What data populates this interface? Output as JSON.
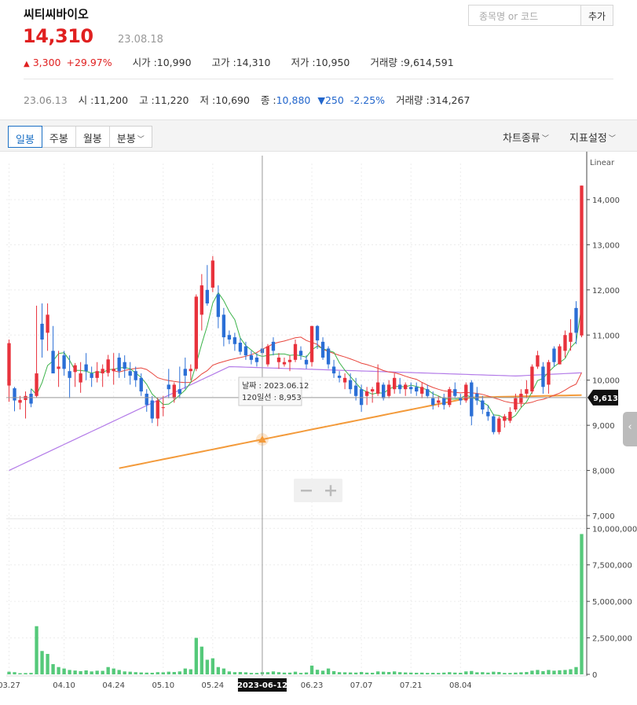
{
  "stock": {
    "name": "씨티씨바이오",
    "price": "14,310",
    "date": "23.08.18",
    "change_arrow": "▲",
    "change": "3,300",
    "change_pct": "+29.97%",
    "open_label": "시가 : ",
    "open": "10,990",
    "high_label": "고가 : ",
    "high": "14,310",
    "low_label": "저가 : ",
    "low": "10,950",
    "volume_label": "거래량 : ",
    "volume": "9,614,591"
  },
  "search": {
    "placeholder": "종목명 or 코드",
    "add_label": "추가"
  },
  "hover_info": {
    "date": "23.06.13",
    "open_label": "시 : ",
    "open": "11,200",
    "high_label": "고 : ",
    "high": "11,220",
    "low_label": "저 : ",
    "low": "10,690",
    "close_label": "종 : ",
    "close": "10,880",
    "change_arrow": "▼",
    "change": "250",
    "change_pct": "-2.25%",
    "volume_label": "거래량 : ",
    "volume": "314,267"
  },
  "toolbar": {
    "tabs": [
      "일봉",
      "주봉",
      "월봉",
      "분봉"
    ],
    "active_tab": 0,
    "chart_type_label": "차트종류",
    "indicator_label": "지표설정"
  },
  "chart_data": {
    "type": "candlestick",
    "scale_label": "Linear",
    "price_ylim": [
      7000,
      14800
    ],
    "price_ticks": [
      7000,
      8000,
      9000,
      10000,
      11000,
      12000,
      13000,
      14000
    ],
    "price_tick_labels": [
      "7,000",
      "8,000",
      "9,000",
      "10,000",
      "11,000",
      "12,000",
      "13,000",
      "14,000"
    ],
    "volume_ylim": [
      0,
      10500000
    ],
    "volume_ticks": [
      0,
      2500000,
      5000000,
      7500000,
      10000000
    ],
    "volume_tick_labels": [
      "0",
      "2,500,000",
      "5,000,000",
      "7,500,000",
      "10,000,000"
    ],
    "x_tick_labels": [
      "03.27",
      "04.10",
      "04.24",
      "05.10",
      "05.24",
      "06.23",
      "07.07",
      "07.21",
      "08.04"
    ],
    "x_tick_index": [
      0,
      10,
      19,
      28,
      37,
      55,
      64,
      73,
      82
    ],
    "crosshair_index": 46,
    "crosshair_date_label": "2023-06-12",
    "crosshair_price": 9613,
    "crosshair_price_label": "9,613",
    "tooltip": {
      "date_label": "날짜 : ",
      "date": "2023.06.12",
      "ma_label": "120일선 : ",
      "ma_value": "8,953"
    },
    "ma_colors": [
      "#3cb34a",
      "#e8453c",
      "#b37be8",
      "#f39a3a"
    ],
    "up_color": "#e8323c",
    "down_color": "#2b6fd6",
    "volume_color": "#55c97a",
    "candles": [
      {
        "o": 9880,
        "h": 10900,
        "l": 9520,
        "c": 10820,
        "v": 180000
      },
      {
        "o": 9820,
        "h": 9850,
        "l": 9310,
        "c": 9550,
        "v": 150000
      },
      {
        "o": 9500,
        "h": 9650,
        "l": 9350,
        "c": 9560,
        "v": 80000
      },
      {
        "o": 9560,
        "h": 9750,
        "l": 9150,
        "c": 9650,
        "v": 90000
      },
      {
        "o": 9700,
        "h": 9800,
        "l": 9400,
        "c": 9480,
        "v": 100000
      },
      {
        "o": 9650,
        "h": 11650,
        "l": 9620,
        "c": 10150,
        "v": 3300000
      },
      {
        "o": 11250,
        "h": 11700,
        "l": 10500,
        "c": 10900,
        "v": 1600000
      },
      {
        "o": 11050,
        "h": 11700,
        "l": 10650,
        "c": 11450,
        "v": 1400000
      },
      {
        "o": 10650,
        "h": 11200,
        "l": 10250,
        "c": 10150,
        "v": 700000
      },
      {
        "o": 10250,
        "h": 10650,
        "l": 9850,
        "c": 10300,
        "v": 500000
      },
      {
        "o": 10550,
        "h": 10650,
        "l": 10100,
        "c": 10250,
        "v": 400000
      },
      {
        "o": 10200,
        "h": 10550,
        "l": 9600,
        "c": 10050,
        "v": 300000
      },
      {
        "o": 10180,
        "h": 10380,
        "l": 9850,
        "c": 10330,
        "v": 260000
      },
      {
        "o": 9950,
        "h": 10400,
        "l": 9720,
        "c": 10150,
        "v": 220000
      },
      {
        "o": 10350,
        "h": 10600,
        "l": 10000,
        "c": 10200,
        "v": 270000
      },
      {
        "o": 10150,
        "h": 10300,
        "l": 9850,
        "c": 10050,
        "v": 200000
      },
      {
        "o": 10050,
        "h": 10400,
        "l": 9950,
        "c": 10200,
        "v": 250000
      },
      {
        "o": 10150,
        "h": 10350,
        "l": 9850,
        "c": 10250,
        "v": 240000
      },
      {
        "o": 10160,
        "h": 10560,
        "l": 10080,
        "c": 10460,
        "v": 500000
      },
      {
        "o": 10200,
        "h": 10600,
        "l": 9900,
        "c": 10250,
        "v": 400000
      },
      {
        "o": 10500,
        "h": 10600,
        "l": 10050,
        "c": 10200,
        "v": 300000
      },
      {
        "o": 10400,
        "h": 10550,
        "l": 10050,
        "c": 10250,
        "v": 200000
      },
      {
        "o": 10200,
        "h": 10400,
        "l": 9900,
        "c": 10100,
        "v": 180000
      },
      {
        "o": 10200,
        "h": 10300,
        "l": 9850,
        "c": 10000,
        "v": 150000
      },
      {
        "o": 10050,
        "h": 10150,
        "l": 9650,
        "c": 9750,
        "v": 130000
      },
      {
        "o": 9700,
        "h": 9800,
        "l": 9300,
        "c": 9450,
        "v": 120000
      },
      {
        "o": 9550,
        "h": 9650,
        "l": 9050,
        "c": 9150,
        "v": 110000
      },
      {
        "o": 9150,
        "h": 9620,
        "l": 8980,
        "c": 9550,
        "v": 150000
      },
      {
        "o": 9400,
        "h": 9650,
        "l": 9200,
        "c": 9400,
        "v": 140000
      },
      {
        "o": 9900,
        "h": 10250,
        "l": 9600,
        "c": 9800,
        "v": 180000
      },
      {
        "o": 9600,
        "h": 9950,
        "l": 9500,
        "c": 9900,
        "v": 160000
      },
      {
        "o": 9800,
        "h": 10300,
        "l": 9600,
        "c": 9700,
        "v": 200000
      },
      {
        "o": 10250,
        "h": 10500,
        "l": 9800,
        "c": 10100,
        "v": 400000
      },
      {
        "o": 10200,
        "h": 10350,
        "l": 10000,
        "c": 10250,
        "v": 350000
      },
      {
        "o": 10250,
        "h": 11900,
        "l": 10200,
        "c": 11850,
        "v": 2500000
      },
      {
        "o": 11450,
        "h": 12350,
        "l": 11100,
        "c": 12100,
        "v": 1900000
      },
      {
        "o": 12000,
        "h": 12550,
        "l": 11650,
        "c": 11700,
        "v": 1000000
      },
      {
        "o": 12050,
        "h": 12750,
        "l": 11950,
        "c": 12650,
        "v": 1100000
      },
      {
        "o": 11900,
        "h": 12100,
        "l": 11150,
        "c": 11400,
        "v": 500000
      },
      {
        "o": 11450,
        "h": 11600,
        "l": 10750,
        "c": 10950,
        "v": 400000
      },
      {
        "o": 11000,
        "h": 11100,
        "l": 10800,
        "c": 10900,
        "v": 200000
      },
      {
        "o": 10950,
        "h": 11050,
        "l": 10650,
        "c": 10800,
        "v": 150000
      },
      {
        "o": 10830,
        "h": 10930,
        "l": 10560,
        "c": 10630,
        "v": 160000
      },
      {
        "o": 10750,
        "h": 10850,
        "l": 10450,
        "c": 10550,
        "v": 140000
      },
      {
        "o": 10550,
        "h": 10650,
        "l": 10350,
        "c": 10450,
        "v": 100000
      },
      {
        "o": 10500,
        "h": 10600,
        "l": 10300,
        "c": 10400,
        "v": 100000
      },
      {
        "o": 10700,
        "h": 10850,
        "l": 10450,
        "c": 10600,
        "v": 150000
      },
      {
        "o": 10350,
        "h": 10800,
        "l": 10300,
        "c": 10750,
        "v": 150000
      },
      {
        "o": 10850,
        "h": 10950,
        "l": 10550,
        "c": 10650,
        "v": 200000
      },
      {
        "o": 10400,
        "h": 10600,
        "l": 10250,
        "c": 10500,
        "v": 150000
      },
      {
        "o": 10350,
        "h": 10500,
        "l": 10300,
        "c": 10400,
        "v": 120000
      },
      {
        "o": 10400,
        "h": 10550,
        "l": 10200,
        "c": 10450,
        "v": 120000
      },
      {
        "o": 10450,
        "h": 10900,
        "l": 10400,
        "c": 10800,
        "v": 180000
      },
      {
        "o": 10650,
        "h": 10750,
        "l": 10450,
        "c": 10550,
        "v": 100000
      },
      {
        "o": 10450,
        "h": 10550,
        "l": 10250,
        "c": 10350,
        "v": 130000
      },
      {
        "o": 10400,
        "h": 11200,
        "l": 10300,
        "c": 11200,
        "v": 600000
      },
      {
        "o": 11200,
        "h": 11220,
        "l": 10690,
        "c": 10880,
        "v": 314267
      },
      {
        "o": 10850,
        "h": 10950,
        "l": 10450,
        "c": 10500,
        "v": 250000
      },
      {
        "o": 10700,
        "h": 10750,
        "l": 10250,
        "c": 10350,
        "v": 400000
      },
      {
        "o": 10300,
        "h": 10450,
        "l": 10050,
        "c": 10150,
        "v": 220000
      },
      {
        "o": 10100,
        "h": 10200,
        "l": 9950,
        "c": 10050,
        "v": 150000
      },
      {
        "o": 9950,
        "h": 10150,
        "l": 9800,
        "c": 10050,
        "v": 140000
      },
      {
        "o": 10000,
        "h": 10150,
        "l": 9700,
        "c": 9800,
        "v": 130000
      },
      {
        "o": 9880,
        "h": 10050,
        "l": 9550,
        "c": 9650,
        "v": 120000
      },
      {
        "o": 9800,
        "h": 9900,
        "l": 9300,
        "c": 9450,
        "v": 160000
      },
      {
        "o": 9650,
        "h": 9850,
        "l": 9450,
        "c": 9750,
        "v": 120000
      },
      {
        "o": 9750,
        "h": 9850,
        "l": 9500,
        "c": 9800,
        "v": 110000
      },
      {
        "o": 9700,
        "h": 10350,
        "l": 9650,
        "c": 9950,
        "v": 200000
      },
      {
        "o": 9900,
        "h": 9950,
        "l": 9550,
        "c": 9600,
        "v": 180000
      },
      {
        "o": 9650,
        "h": 10000,
        "l": 9600,
        "c": 9900,
        "v": 160000
      },
      {
        "o": 9800,
        "h": 10150,
        "l": 9700,
        "c": 10050,
        "v": 200000
      },
      {
        "o": 9900,
        "h": 10050,
        "l": 9700,
        "c": 9800,
        "v": 150000
      },
      {
        "o": 9800,
        "h": 9950,
        "l": 9650,
        "c": 9900,
        "v": 130000
      },
      {
        "o": 9850,
        "h": 9950,
        "l": 9700,
        "c": 9800,
        "v": 120000
      },
      {
        "o": 9850,
        "h": 9950,
        "l": 9650,
        "c": 9750,
        "v": 110000
      },
      {
        "o": 9700,
        "h": 9950,
        "l": 9600,
        "c": 9850,
        "v": 120000
      },
      {
        "o": 9800,
        "h": 9900,
        "l": 9600,
        "c": 9650,
        "v": 100000
      },
      {
        "o": 9600,
        "h": 9750,
        "l": 9350,
        "c": 9450,
        "v": 110000
      },
      {
        "o": 9500,
        "h": 9650,
        "l": 9400,
        "c": 9550,
        "v": 100000
      },
      {
        "o": 9600,
        "h": 9700,
        "l": 9350,
        "c": 9450,
        "v": 120000
      },
      {
        "o": 9450,
        "h": 9850,
        "l": 9400,
        "c": 9800,
        "v": 150000
      },
      {
        "o": 9800,
        "h": 9950,
        "l": 9600,
        "c": 9650,
        "v": 120000
      },
      {
        "o": 9600,
        "h": 9700,
        "l": 9450,
        "c": 9550,
        "v": 110000
      },
      {
        "o": 9550,
        "h": 9950,
        "l": 9500,
        "c": 9900,
        "v": 200000
      },
      {
        "o": 9950,
        "h": 10000,
        "l": 9000,
        "c": 9200,
        "v": 230000
      },
      {
        "o": 9700,
        "h": 9850,
        "l": 9450,
        "c": 9550,
        "v": 140000
      },
      {
        "o": 9550,
        "h": 9650,
        "l": 9250,
        "c": 9350,
        "v": 150000
      },
      {
        "o": 9300,
        "h": 9450,
        "l": 9100,
        "c": 9200,
        "v": 120000
      },
      {
        "o": 9200,
        "h": 9250,
        "l": 8800,
        "c": 8850,
        "v": 180000
      },
      {
        "o": 8850,
        "h": 9200,
        "l": 8800,
        "c": 9150,
        "v": 160000
      },
      {
        "o": 9100,
        "h": 9250,
        "l": 8950,
        "c": 9200,
        "v": 100000
      },
      {
        "o": 9100,
        "h": 9400,
        "l": 9050,
        "c": 9300,
        "v": 100000
      },
      {
        "o": 9350,
        "h": 9700,
        "l": 9300,
        "c": 9600,
        "v": 120000
      },
      {
        "o": 9500,
        "h": 9800,
        "l": 9400,
        "c": 9700,
        "v": 140000
      },
      {
        "o": 9700,
        "h": 10000,
        "l": 9600,
        "c": 9800,
        "v": 160000
      },
      {
        "o": 9750,
        "h": 10350,
        "l": 9700,
        "c": 10300,
        "v": 250000
      },
      {
        "o": 10300,
        "h": 10650,
        "l": 10250,
        "c": 10550,
        "v": 300000
      },
      {
        "o": 10300,
        "h": 10400,
        "l": 9700,
        "c": 9850,
        "v": 220000
      },
      {
        "o": 9900,
        "h": 10450,
        "l": 9700,
        "c": 10400,
        "v": 300000
      },
      {
        "o": 10700,
        "h": 10750,
        "l": 10300,
        "c": 10400,
        "v": 250000
      },
      {
        "o": 10350,
        "h": 10800,
        "l": 10350,
        "c": 10750,
        "v": 280000
      },
      {
        "o": 10650,
        "h": 11100,
        "l": 10500,
        "c": 11000,
        "v": 300000
      },
      {
        "o": 10850,
        "h": 11350,
        "l": 10650,
        "c": 11050,
        "v": 350000
      },
      {
        "o": 11600,
        "h": 11750,
        "l": 10800,
        "c": 11050,
        "v": 500000
      },
      {
        "o": 10990,
        "h": 14310,
        "l": 10950,
        "c": 14310,
        "v": 9614591
      }
    ]
  }
}
